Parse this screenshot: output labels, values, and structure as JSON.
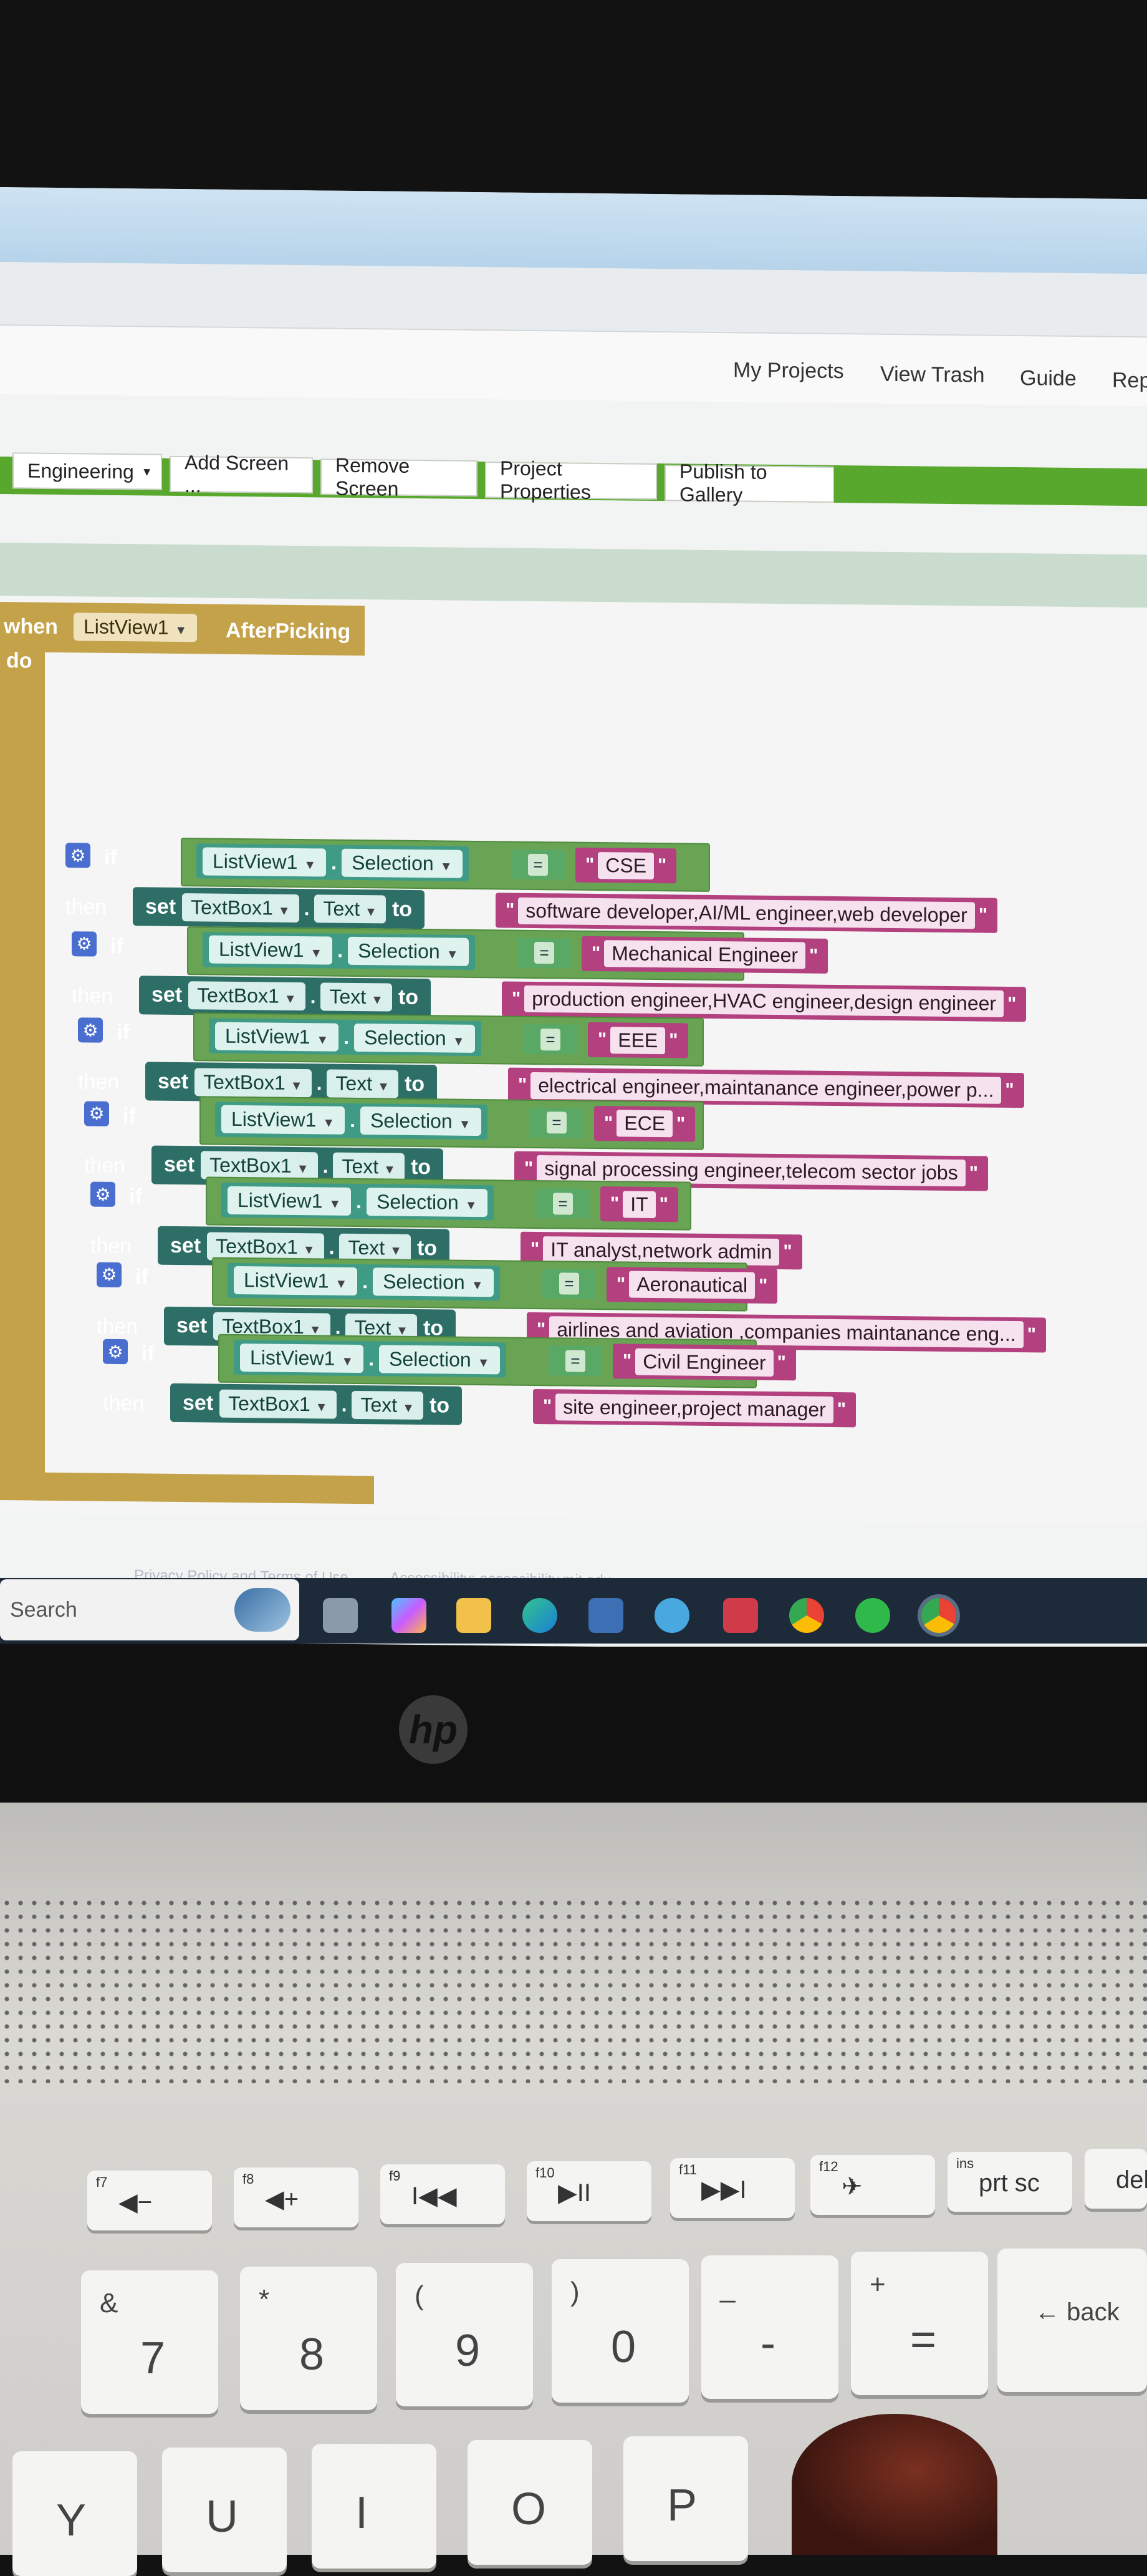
{
  "nav": {
    "my_projects": "My Projects",
    "view_trash": "View Trash",
    "guide": "Guide",
    "report": "Rep"
  },
  "toolbar": {
    "screen_select": "Engineering",
    "add_screen": "Add Screen ...",
    "remove_screen": "Remove Screen",
    "project_properties": "Project Properties",
    "publish": "Publish to Gallery"
  },
  "event": {
    "when": "when",
    "component": "ListView1",
    "event_name": "AfterPicking",
    "do": "do"
  },
  "blocks_text": {
    "if": "if",
    "then": "then",
    "set": "set",
    "to": "to",
    "dot": ".",
    "eq": "=",
    "selection": "Selection",
    "text": "Text",
    "target": "TextBox1",
    "source": "ListView1"
  },
  "branches": [
    {
      "match": "CSE",
      "result": "software developer,AI/ML engineer,web developer"
    },
    {
      "match": "Mechanical Engineer",
      "result": "production engineer,HVAC engineer,design engineer"
    },
    {
      "match": "EEE",
      "result": "electrical engineer,maintanance engineer,power p..."
    },
    {
      "match": "ECE",
      "result": "signal processing engineer,telecom sector jobs"
    },
    {
      "match": "IT",
      "result": "IT analyst,network admin"
    },
    {
      "match": "Aeronautical",
      "result": "airlines and aviation ,companies maintanance eng..."
    },
    {
      "match": "Civil Engineer",
      "result": "site engineer,project manager"
    }
  ],
  "footer": {
    "privacy": "Privacy Policy and Terms of Use",
    "accessibility": "Accessibility: accessibility.mit.edu"
  },
  "taskbar": {
    "search_placeholder": "Search"
  },
  "keyboard": {
    "fkeys": [
      {
        "label": "f7",
        "icon": "◀−"
      },
      {
        "label": "f8",
        "icon": "◀+"
      },
      {
        "label": "f9",
        "icon": "I◀◀"
      },
      {
        "label": "f10",
        "icon": "▶II"
      },
      {
        "label": "f11",
        "icon": "▶▶I"
      },
      {
        "label": "f12",
        "icon": "✈"
      },
      {
        "label": "ins",
        "icon": "prt sc"
      },
      {
        "label": "",
        "icon": "del"
      }
    ],
    "numkeys": [
      {
        "top": "&",
        "main": "7"
      },
      {
        "top": "*",
        "main": "8"
      },
      {
        "top": "(",
        "main": "9"
      },
      {
        "top": ")",
        "main": "0"
      },
      {
        "top": "_",
        "main": "-"
      },
      {
        "top": "+",
        "main": "="
      }
    ],
    "backspace": "← back",
    "letters": [
      "Y",
      "U",
      "I",
      "O",
      "P"
    ]
  }
}
